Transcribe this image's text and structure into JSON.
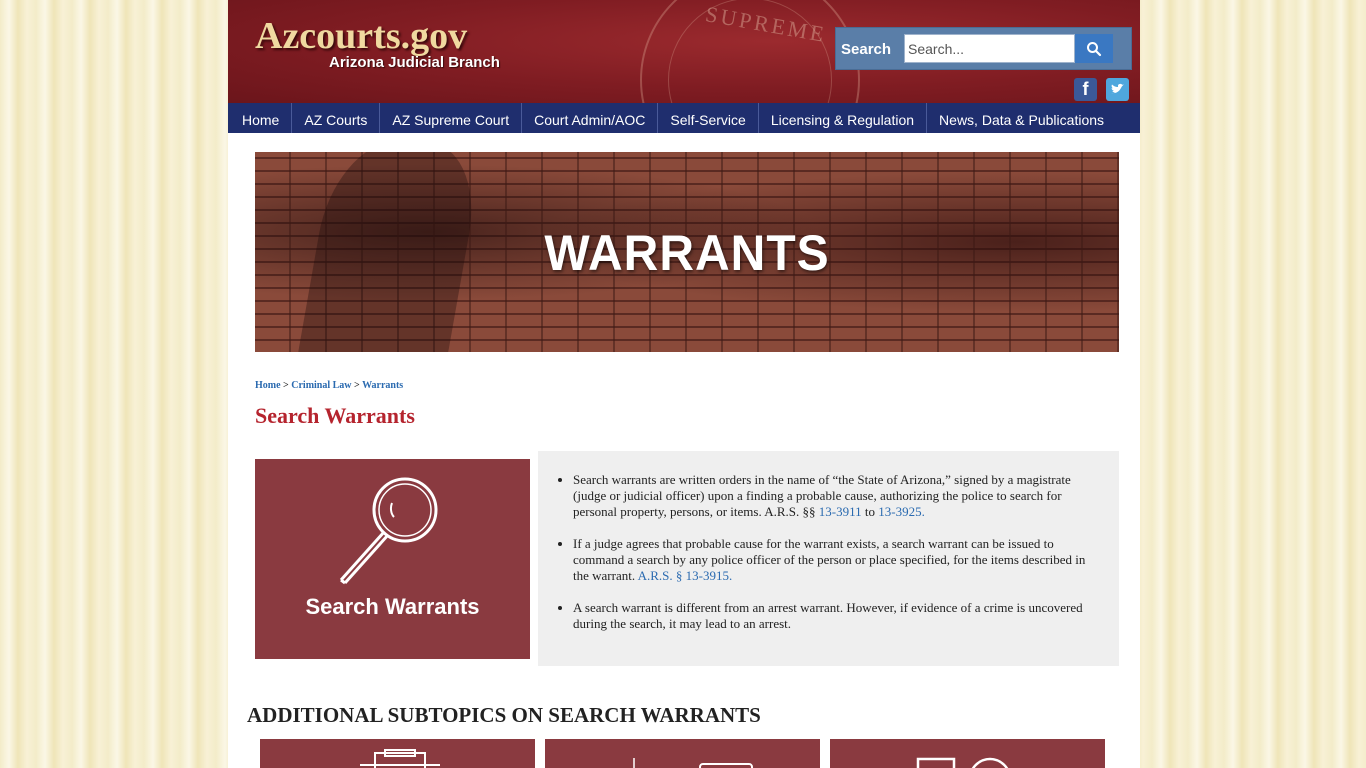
{
  "header": {
    "logo_title": "Azcourts.gov",
    "logo_subtitle": "Arizona Judicial Branch",
    "seal_text": "SUPREME COURT",
    "search_label": "Search",
    "search_placeholder": "Search...",
    "social": [
      "facebook-icon",
      "twitter-icon"
    ]
  },
  "nav": {
    "items": [
      "Home",
      "AZ Courts",
      "AZ Supreme Court",
      "Court Admin/AOC",
      "Self-Service",
      "Licensing & Regulation",
      "News, Data & Publications"
    ]
  },
  "banner": {
    "title": "WARRANTS"
  },
  "breadcrumb": {
    "items": [
      "Home",
      "Criminal Law",
      "Warrants"
    ],
    "separator": ">"
  },
  "page_title": "Search Warrants",
  "card": {
    "title": "Search Warrants",
    "icon": "magnifying-glass-icon"
  },
  "bullets": [
    {
      "text": "Search warrants are written orders in the name of “the State of Arizona,” signed by a magistrate (judge or judicial officer) upon a finding a probable cause, authorizing the police to search for personal property, persons, or items. A.R.S. §§ ",
      "link1": "13-3911",
      "mid": " to ",
      "link2": "13-3925",
      "end": "."
    },
    {
      "text": "If a judge agrees that probable cause for the warrant exists, a search warrant can be issued to command a search by any police officer of the person or place specified, for the items described in the warrant. ",
      "link1": "A.R.S. § 13-3915",
      "end": "."
    },
    {
      "text": "A search warrant is different from an arrest warrant. However, if evidence of a crime is uncovered during the search, it may lead to an arrest."
    }
  ],
  "subtopics_title": "ADDITIONAL SUBTOPICS ON SEARCH WARRANTS",
  "colors": {
    "header_red": "#7f1c22",
    "nav_blue": "#1f2e6e",
    "card_maroon": "#8a3a40",
    "title_red": "#b5242e",
    "link_blue": "#2a6ab0"
  }
}
